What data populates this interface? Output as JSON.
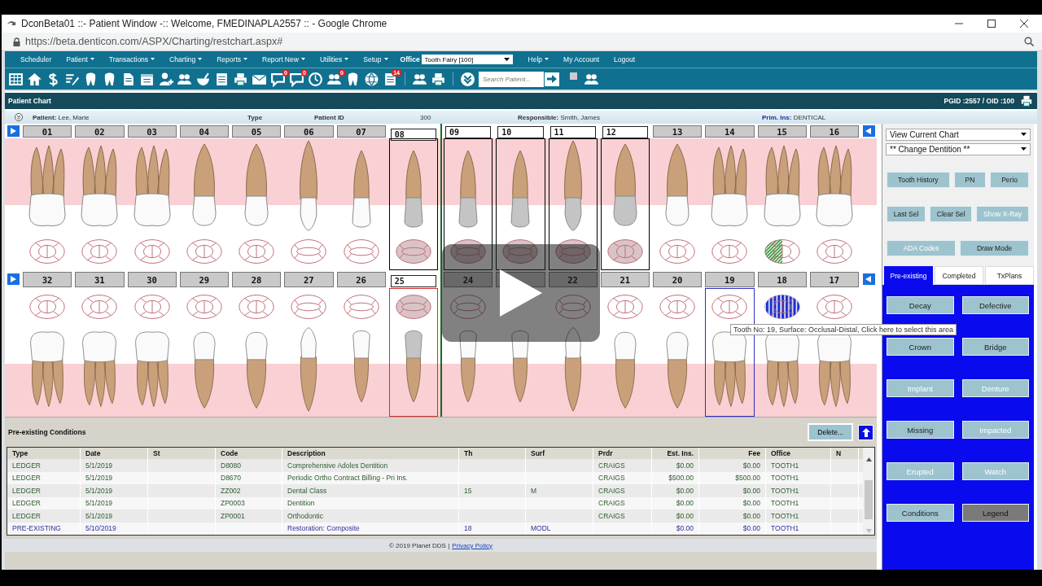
{
  "browser": {
    "title": "DconBeta01 ::- Patient Window -:: Welcome, FMEDINAPLA2557 :: - Google Chrome",
    "url": "https://beta.denticon.com/ASPX/Charting/restchart.aspx#"
  },
  "menu": [
    {
      "label": "Scheduler",
      "has_menu": false
    },
    {
      "label": "Patient",
      "has_menu": true
    },
    {
      "label": "Transactions",
      "has_menu": true
    },
    {
      "label": "Charting",
      "has_menu": true
    },
    {
      "label": "Reports",
      "has_menu": true
    },
    {
      "label": "Report New",
      "has_menu": true
    },
    {
      "label": "Utilities",
      "has_menu": true
    },
    {
      "label": "Setup",
      "has_menu": true
    }
  ],
  "office": {
    "label": "Office",
    "value": "Tooth Fairy [100]"
  },
  "menu_right": [
    {
      "label": "Help",
      "has_menu": true
    },
    {
      "label": "My Account",
      "has_menu": false
    },
    {
      "label": "Logout",
      "has_menu": false
    }
  ],
  "toolbar": {
    "badges": [
      "0",
      "0",
      "0",
      "14"
    ],
    "search_placeholder": "Search Patient...",
    "checkbox_checked": false
  },
  "header": {
    "title": "Patient Chart",
    "ids": "PGID :2557 / OID :100"
  },
  "patient": {
    "patient_label": "Patient:",
    "patient": "Lee, Marie",
    "type_label": "Type",
    "id_label": "Patient ID",
    "id": "300",
    "responsible_label": "Responsible:",
    "responsible": "Smith, James",
    "insurance_label": "Prim. Ins:",
    "insurance": "DENTICAL"
  },
  "chart": {
    "upper": [
      {
        "number": "01",
        "kind": "molar",
        "selected": false
      },
      {
        "number": "02",
        "kind": "molar",
        "selected": false
      },
      {
        "number": "03",
        "kind": "molar",
        "selected": false
      },
      {
        "number": "04",
        "kind": "premolar",
        "selected": false
      },
      {
        "number": "05",
        "kind": "premolar",
        "selected": false
      },
      {
        "number": "06",
        "kind": "canine",
        "selected": false
      },
      {
        "number": "07",
        "kind": "incisor",
        "selected": false
      },
      {
        "number": "08",
        "kind": "incisor",
        "selected": true,
        "color": "#000000"
      },
      {
        "number": "09",
        "kind": "incisor",
        "selected": true,
        "color": "#000000"
      },
      {
        "number": "10",
        "kind": "incisor",
        "selected": true,
        "color": "#000000"
      },
      {
        "number": "11",
        "kind": "canine",
        "selected": true,
        "color": "#000000"
      },
      {
        "number": "12",
        "kind": "premolar",
        "selected": true,
        "color": "#000000"
      },
      {
        "number": "13",
        "kind": "premolar",
        "selected": false
      },
      {
        "number": "14",
        "kind": "molar",
        "selected": false
      },
      {
        "number": "15",
        "kind": "molar",
        "selected": false,
        "hatched": true
      },
      {
        "number": "16",
        "kind": "molar",
        "selected": false
      }
    ],
    "lower": [
      {
        "number": "32",
        "kind": "molar",
        "selected": false
      },
      {
        "number": "31",
        "kind": "molar",
        "selected": false
      },
      {
        "number": "30",
        "kind": "molar",
        "selected": false
      },
      {
        "number": "29",
        "kind": "premolar",
        "selected": false
      },
      {
        "number": "28",
        "kind": "premolar",
        "selected": false
      },
      {
        "number": "27",
        "kind": "canine",
        "selected": false
      },
      {
        "number": "26",
        "kind": "incisor",
        "selected": false
      },
      {
        "number": "25",
        "kind": "incisor",
        "selected": true,
        "color": "#d03030"
      },
      {
        "number": "24",
        "kind": "incisor",
        "selected": false
      },
      {
        "kind": "incisor",
        "selected": false
      },
      {
        "number": "22",
        "kind": "canine",
        "selected": false
      },
      {
        "number": "21",
        "kind": "premolar",
        "selected": false
      },
      {
        "number": "20",
        "kind": "premolar",
        "selected": false
      },
      {
        "number": "19",
        "kind": "molar",
        "selected": false,
        "color": "#3030c0"
      },
      {
        "number": "18",
        "kind": "molar",
        "selected": false,
        "striped": true
      },
      {
        "number": "17",
        "kind": "molar",
        "selected": false
      }
    ],
    "tooltip": "Tooth No: 19, Surface: Occlusal-Distal, Click here to select this area"
  },
  "conditions": {
    "title": "Pre-existing Conditions",
    "delete": "Delete...",
    "columns": [
      "Type",
      "Date",
      "St",
      "Code",
      "Description",
      "Th",
      "Surf",
      "Prdr",
      "Est. Ins.",
      "Fee",
      "Office",
      "N"
    ],
    "rows": [
      {
        "kind": "ledger",
        "type": "LEDGER",
        "date": "5/1/2019",
        "code": "D8080",
        "description": "Comprehensive Adoles Dentition",
        "prdr": "CRAIGS",
        "est_ins": "$0.00",
        "fee": "$0.00",
        "office": "TOOTH1"
      },
      {
        "kind": "ledger",
        "type": "LEDGER",
        "date": "5/1/2019",
        "code": "D8670",
        "description": "Periodic Ortho Contract Billing - Pri Ins.",
        "prdr": "CRAIGS",
        "est_ins": "$500.00",
        "fee": "$500.00",
        "office": "TOOTH1"
      },
      {
        "kind": "ledger",
        "type": "LEDGER",
        "date": "5/1/2019",
        "code": "ZZ002",
        "description": "Dental Class",
        "th": "15",
        "surf": "M",
        "prdr": "CRAIGS",
        "est_ins": "$0.00",
        "fee": "$0.00",
        "office": "TOOTH1"
      },
      {
        "kind": "ledger",
        "type": "LEDGER",
        "date": "5/1/2019",
        "code": "ZP0003",
        "description": "Dentition",
        "prdr": "CRAIGS",
        "est_ins": "$0.00",
        "fee": "$0.00",
        "office": "TOOTH1"
      },
      {
        "kind": "ledger",
        "type": "LEDGER",
        "date": "5/1/2019",
        "code": "ZP0001",
        "description": "Orthodontic",
        "prdr": "CRAIGS",
        "est_ins": "$0.00",
        "fee": "$0.00",
        "office": "TOOTH1"
      },
      {
        "kind": "pre-existing",
        "type": "PRE-EXISTING",
        "date": "5/10/2019",
        "description": "Restoration: Composite",
        "th": "18",
        "surf": "MODL",
        "est_ins": "$0.00",
        "fee": "$0.00",
        "office": "TOOTH1"
      }
    ]
  },
  "side": {
    "selects": [
      "View Current Chart",
      "** Change Dentition **"
    ],
    "button_rows": [
      [
        {
          "label": "Tooth History",
          "disabled": false
        },
        {
          "label": "PN",
          "disabled": false
        },
        {
          "label": "Perio",
          "disabled": false
        }
      ],
      [
        {
          "label": "Last Sel",
          "disabled": false
        },
        {
          "label": "Clear Sel",
          "disabled": false
        },
        {
          "label": "Show X-Ray",
          "disabled": true
        }
      ],
      [
        {
          "label": "ADA Codes",
          "disabled": true
        },
        {
          "label": "Draw Mode",
          "disabled": false
        }
      ]
    ],
    "tabs": [
      {
        "label": "Pre-existing",
        "selected": true
      },
      {
        "label": "Completed",
        "selected": false
      },
      {
        "label": "TxPlans",
        "selected": false
      }
    ],
    "condition_buttons": [
      {
        "label": "Decay",
        "disabled": false,
        "pressed": false
      },
      {
        "label": "Defective",
        "disabled": false,
        "pressed": false
      },
      {
        "label": "Crown",
        "disabled": false,
        "pressed": false
      },
      {
        "label": "Bridge",
        "disabled": false,
        "pressed": false
      },
      {
        "label": "Implant",
        "disabled": true,
        "pressed": false
      },
      {
        "label": "Denture",
        "disabled": true,
        "pressed": false
      },
      {
        "label": "Missing",
        "disabled": false,
        "pressed": false
      },
      {
        "label": "Impacted",
        "disabled": true,
        "pressed": false
      },
      {
        "label": "Erupted",
        "disabled": true,
        "pressed": false
      },
      {
        "label": "Watch",
        "disabled": true,
        "pressed": false
      },
      {
        "label": "Conditions",
        "disabled": false,
        "pressed": false
      },
      {
        "label": "Legend",
        "disabled": false,
        "pressed": true
      }
    ]
  },
  "footer": {
    "copyright": "© 2019 Planet DDS |",
    "link": "Privacy Policy"
  }
}
